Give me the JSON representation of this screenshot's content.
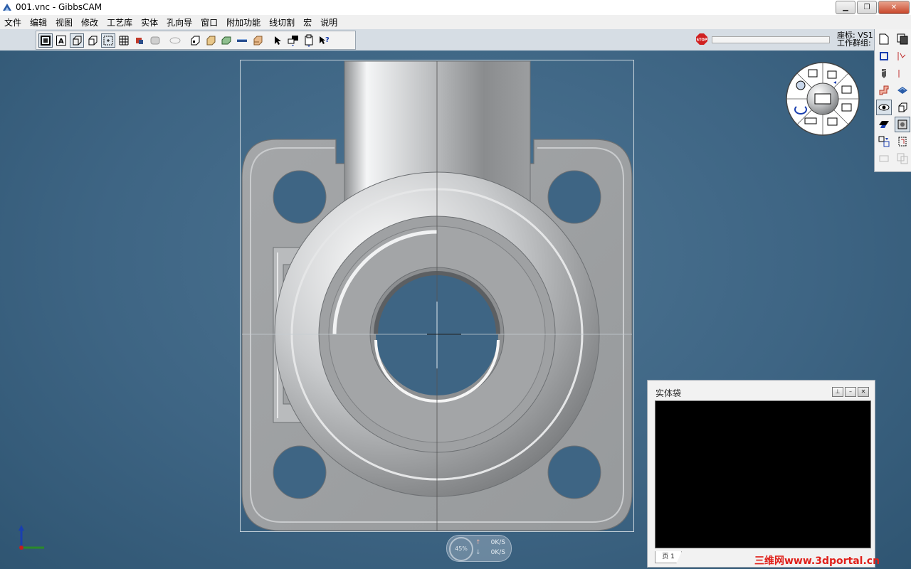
{
  "window": {
    "title": "001.vnc - GibbsCAM",
    "buttons": [
      "minimize",
      "restore",
      "close"
    ]
  },
  "menu": [
    "文件",
    "编辑",
    "视图",
    "修改",
    "工艺库",
    "实体",
    "孔向导",
    "窗口",
    "附加功能",
    "线切割",
    "宏",
    "说明"
  ],
  "toolbar": {
    "icons": [
      "show-all-icon",
      "text-icon",
      "solid-icon",
      "box-icon",
      "point-icon",
      "grid-icon",
      "tool-icon",
      "shell-icon",
      "shape-icon",
      "box-open-icon",
      "stock-icon",
      "block-icon",
      "bar-icon",
      "layer-icon",
      "pointer-icon",
      "pan-icon",
      "orientation-icon",
      "help-pointer-icon"
    ]
  },
  "status": {
    "coord_line1": "座标: VS1",
    "coord_line2": "工作群组:"
  },
  "solid_bag": {
    "title": "实体袋",
    "tab": "页 1"
  },
  "net_meter": {
    "percent": "45%",
    "up": "0K/S",
    "down": "0K/S"
  },
  "watermark": "三维网www.3dportal.cn",
  "colors": {
    "background": "#3e6584",
    "part": "#9ea0a2",
    "window_close": "#c8462a"
  }
}
